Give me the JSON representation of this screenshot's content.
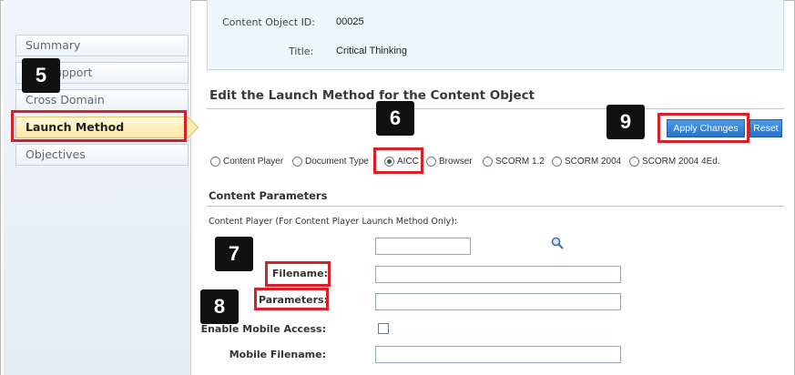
{
  "sidebar": {
    "items": [
      {
        "label": "Summary"
      },
      {
        "label": "Support"
      },
      {
        "label": "Cross Domain"
      },
      {
        "label": "Launch Method"
      },
      {
        "label": "Objectives"
      }
    ]
  },
  "info": {
    "id_label": "Content Object ID:",
    "id_value": "00025",
    "title_label": "Title:",
    "title_value": "Critical Thinking"
  },
  "section_title": "Edit the Launch Method for the Content Object",
  "buttons": {
    "apply": "Apply Changes",
    "reset": "Reset"
  },
  "launch_options": [
    {
      "label": "Content Player",
      "checked": false
    },
    {
      "label": "Document Type",
      "checked": false
    },
    {
      "label": "AICC",
      "checked": true
    },
    {
      "label": "Browser",
      "checked": false
    },
    {
      "label": "SCORM 1.2",
      "checked": false
    },
    {
      "label": "SCORM 2004",
      "checked": false
    },
    {
      "label": "SCORM 2004 4Ed.",
      "checked": false
    }
  ],
  "params": {
    "heading": "Content Parameters",
    "note": "Content Player (For Content Player Launch Method Only):",
    "filename_label": "Filename:",
    "parameters_label": "Parameters:",
    "mobile_access_label": "Enable Mobile Access:",
    "mobile_filename_label": "Mobile Filename:",
    "search_value": "",
    "filename_value": "",
    "parameters_value": "",
    "mobile_filename_value": "",
    "mobile_access_checked": false
  },
  "callouts": [
    "5",
    "6",
    "7",
    "8",
    "9"
  ],
  "colors": {
    "highlight": "#d6202a",
    "accent": "#2a72c6",
    "active_nav": "#fde9a6"
  }
}
